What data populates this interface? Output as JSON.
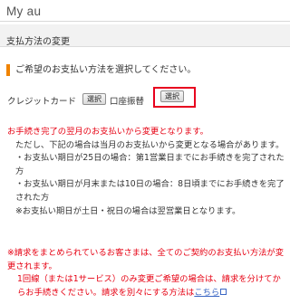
{
  "header": {
    "logo": "My au"
  },
  "page": {
    "title": "支払方法の変更"
  },
  "section": {
    "heading": "ご希望のお支払い方法を選択してください。"
  },
  "payment": {
    "credit_label": "クレジットカード",
    "credit_button": "選択",
    "koza_label": "口座振替",
    "koza_button": "選択"
  },
  "notice": {
    "line1": "お手続き完了の翌月のお支払いから変更となります。",
    "line2": "ただし、下記の場合は当月のお支払いから変更となる場合があります。",
    "line3": "・お支払い期日が25日の場合：第1営業日までにお手続きを完了された方",
    "line4": "・お支払い期日が月末または10日の場合：8日頃までにお手続きを完了された方",
    "line5": "※お支払い期日が土日・祝日の場合は翌営業日となります。"
  },
  "notice2": {
    "line1": "※請求をまとめられているお客さまは、全てのご契約のお支払い方法が変更されます。",
    "line2": "1回線（または1サービス）のみ変更ご希望の場合は、請求を分けてからお手続きください。請求を別々にする方法は",
    "link": "こちら"
  }
}
